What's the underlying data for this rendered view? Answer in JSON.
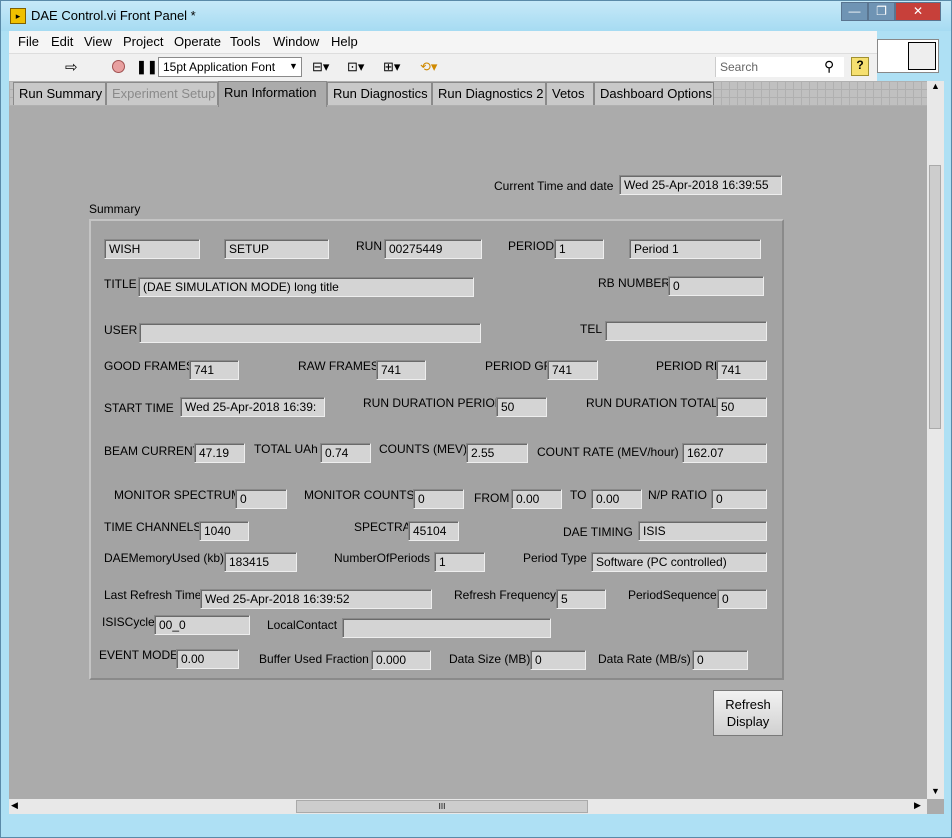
{
  "window": {
    "title": "DAE Control.vi Front Panel *",
    "min": "—",
    "max": "❐",
    "close": "✕"
  },
  "menu": [
    "File",
    "Edit",
    "View",
    "Project",
    "Operate",
    "Tools",
    "Window",
    "Help"
  ],
  "toolbar": {
    "font": "15pt Application Font",
    "search_placeholder": "Search",
    "help": "?"
  },
  "tabs": [
    "Run Summary",
    "Experiment Setup",
    "Run Information",
    "Run Diagnostics",
    "Run Diagnostics 2",
    "Vetos",
    "Dashboard Options"
  ],
  "current_time": {
    "label": "Current Time and date",
    "value": "Wed 25-Apr-2018  16:39:55"
  },
  "summary": {
    "title": "Summary",
    "inst": "WISH",
    "state": "SETUP",
    "run_label": "RUN",
    "run": "00275449",
    "period_label": "PERIOD",
    "period": "1",
    "period_name": "Period 1",
    "title_label": "TITLE",
    "run_title": "(DAE SIMULATION MODE) long title",
    "rb_label": "RB NUMBER",
    "rb": "0",
    "user_label": "USER",
    "user": "",
    "tel_label": "TEL",
    "tel": "",
    "good_frames_label": "GOOD FRAMES",
    "good_frames": "741",
    "raw_frames_label": "RAW FRAMES",
    "raw_frames": "741",
    "period_gf_label": "PERIOD GF",
    "period_gf": "741",
    "period_rf_label": "PERIOD RF",
    "period_rf": "741",
    "start_time_label": "START TIME",
    "start_time": "Wed 25-Apr-2018 16:39:",
    "run_dur_period_label": "RUN DURATION PERIOD",
    "run_dur_period": "50",
    "run_dur_total_label": "RUN DURATION TOTAL",
    "run_dur_total": "50",
    "beam_current_label": "BEAM CURRENT",
    "beam_current": "47.19",
    "total_uah_label": "TOTAL UAh",
    "total_uah": "0.74",
    "counts_label": "COUNTS (MEV)",
    "counts": "2.55",
    "count_rate_label": "COUNT RATE (MEV/hour)",
    "count_rate": "162.07",
    "monitor_spectrum_label": "MONITOR SPECTRUM",
    "monitor_spectrum": "0",
    "monitor_counts_label": "MONITOR COUNTS",
    "monitor_counts": "0",
    "from_label": "FROM",
    "from": "0.00",
    "to_label": "TO",
    "to": "0.00",
    "np_ratio_label": "N/P RATIO",
    "np_ratio": "0",
    "time_channels_label": "TIME CHANNELS",
    "time_channels": "1040",
    "spectra_label": "SPECTRA",
    "spectra": "45104",
    "dae_timing_label": "DAE TIMING",
    "dae_timing": "ISIS",
    "dae_memory_label": "DAEMemoryUsed (kb)",
    "dae_memory": "183415",
    "num_periods_label": "NumberOfPeriods",
    "num_periods": "1",
    "period_type_label": "Period Type",
    "period_type": "Software (PC controlled)",
    "last_refresh_label": "Last Refresh Time",
    "last_refresh": "Wed 25-Apr-2018 16:39:52",
    "refresh_freq_label": "Refresh Frequency",
    "refresh_freq": "5",
    "period_seq_label": "PeriodSequence",
    "period_seq": "0",
    "isis_cycle_label": "ISISCycle",
    "isis_cycle": "00_0",
    "local_contact_label": "LocalContact",
    "local_contact": "",
    "event_mode_label": "EVENT MODE",
    "event_mode": "0.00",
    "buffer_label": "Buffer Used Fraction",
    "buffer": "0.000",
    "data_size_label": "Data Size (MB)",
    "data_size": "0",
    "data_rate_label": "Data Rate (MB/s)",
    "data_rate": "0"
  },
  "refresh_button": {
    "line1": "Refresh",
    "line2": "Display"
  },
  "hscroll_grip": "III",
  "colors": {
    "panel": "#ababab",
    "field": "#d4d4d4",
    "titlebar": "#aee0f4"
  }
}
